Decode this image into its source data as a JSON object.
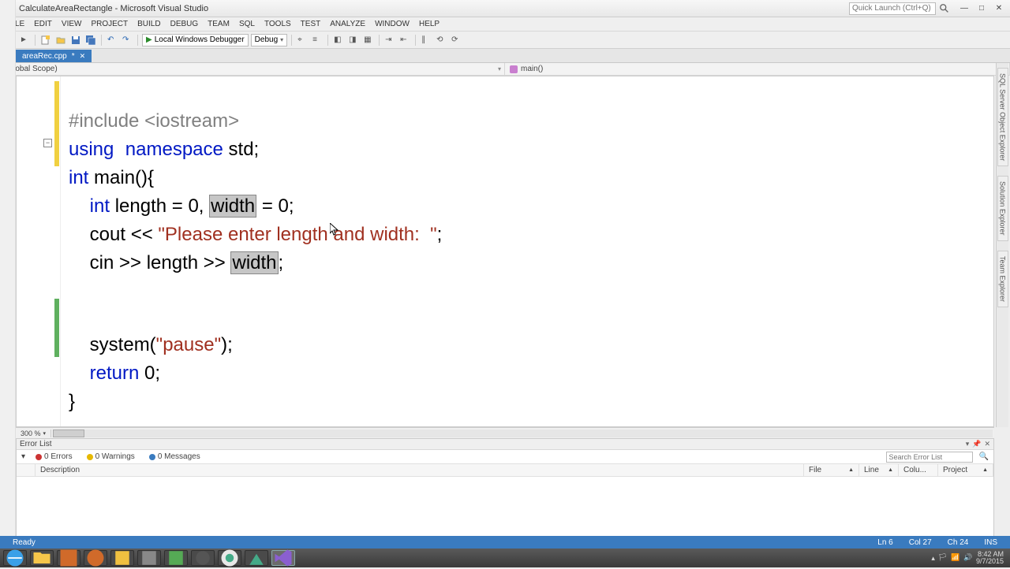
{
  "window": {
    "title": "CalculateAreaRectangle - Microsoft Visual Studio",
    "quick_launch_placeholder": "Quick Launch (Ctrl+Q)"
  },
  "menu": [
    "FILE",
    "EDIT",
    "VIEW",
    "PROJECT",
    "BUILD",
    "DEBUG",
    "TEAM",
    "SQL",
    "TOOLS",
    "TEST",
    "ANALYZE",
    "WINDOW",
    "HELP"
  ],
  "toolbar": {
    "debugger_label": "Local Windows Debugger",
    "config": "Debug"
  },
  "tab": {
    "filename": "areaRec.cpp",
    "dirty": "*"
  },
  "nav": {
    "scope": "(Global Scope)",
    "member": "main()"
  },
  "code": {
    "l1_pp": "#include ",
    "l1_hdr": "<iostream>",
    "l2_kw1": "using",
    "l2_kw2": "namespace",
    "l2_rest": " std;",
    "l3_kw": "int",
    "l3_rest": " main(){",
    "l4_indent": "    ",
    "l4_kw": "int",
    "l4_a": " length = 0, ",
    "l4_hl": "width",
    "l4_b": " = 0;",
    "l5_indent": "    ",
    "l5_a": "cout << ",
    "l5_str": "\"Please enter length and width:  \"",
    "l5_b": ";",
    "l6_indent": "    ",
    "l6_a": "cin >> length >> ",
    "l6_hl": "width",
    "l6_b": ";",
    "l9_indent": "    ",
    "l9_a": "system(",
    "l9_str": "\"pause\"",
    "l9_b": ");",
    "l10_indent": "    ",
    "l10_kw": "return",
    "l10_rest": " 0;",
    "l11": "}"
  },
  "zoom": "300 %",
  "right_tabs": [
    "SQL Server Object Explorer",
    "Solution Explorer",
    "Team Explorer"
  ],
  "errorlist": {
    "title": "Error List",
    "errors": "0 Errors",
    "warnings": "0 Warnings",
    "messages": "0 Messages",
    "search_placeholder": "Search Error List",
    "columns": {
      "desc": "Description",
      "file": "File",
      "line": "Line",
      "col": "Colu...",
      "proj": "Project"
    }
  },
  "status": {
    "ready": "Ready",
    "ln": "Ln 6",
    "col": "Col 27",
    "ch": "Ch 24",
    "ins": "INS"
  },
  "tray": {
    "time": "8:42 AM",
    "date": "9/7/2015"
  }
}
